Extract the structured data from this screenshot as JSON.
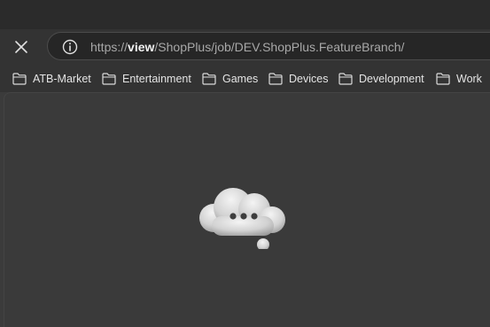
{
  "toolbar": {
    "close_icon": "close-icon",
    "info_icon": "info-icon",
    "url": {
      "scheme": "https://",
      "host": "view",
      "path": "/ShopPlus/job/DEV.ShopPlus.FeatureBranch/"
    }
  },
  "bookmarks": [
    {
      "label": "ATB-Market",
      "icon": "folder-icon"
    },
    {
      "label": "Entertainment",
      "icon": "folder-icon"
    },
    {
      "label": "Games",
      "icon": "folder-icon"
    },
    {
      "label": "Devices",
      "icon": "folder-icon"
    },
    {
      "label": "Development",
      "icon": "folder-icon"
    },
    {
      "label": "Work",
      "icon": "folder-icon"
    }
  ],
  "content": {
    "illustration": "thinking-cloud-icon"
  },
  "colors": {
    "titlebar": "#2b2b2b",
    "toolbar": "#333333",
    "content": "#3a3a3a",
    "omnibox": "#262626"
  }
}
